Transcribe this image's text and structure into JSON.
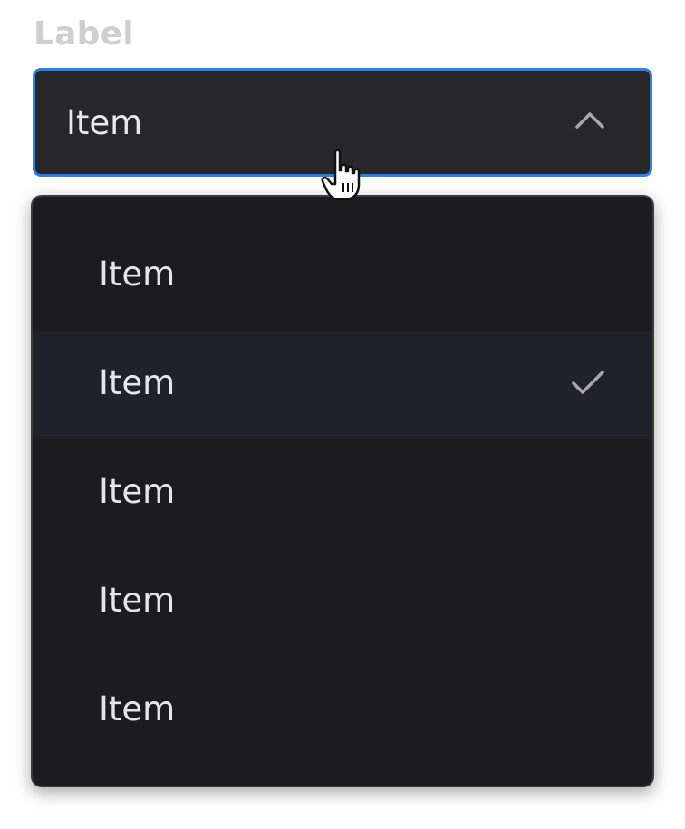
{
  "field": {
    "label": "Label",
    "selected_value": "Item",
    "open": true,
    "focus_color": "#2f7fe0"
  },
  "dropdown": {
    "items": [
      {
        "label": "Item",
        "selected": false
      },
      {
        "label": "Item",
        "selected": true
      },
      {
        "label": "Item",
        "selected": false
      },
      {
        "label": "Item",
        "selected": false
      },
      {
        "label": "Item",
        "selected": false
      }
    ]
  },
  "icons": {
    "toggle": "chevron-up-icon",
    "selected_mark": "checkmark-icon",
    "pointer": "hand-cursor-icon"
  }
}
